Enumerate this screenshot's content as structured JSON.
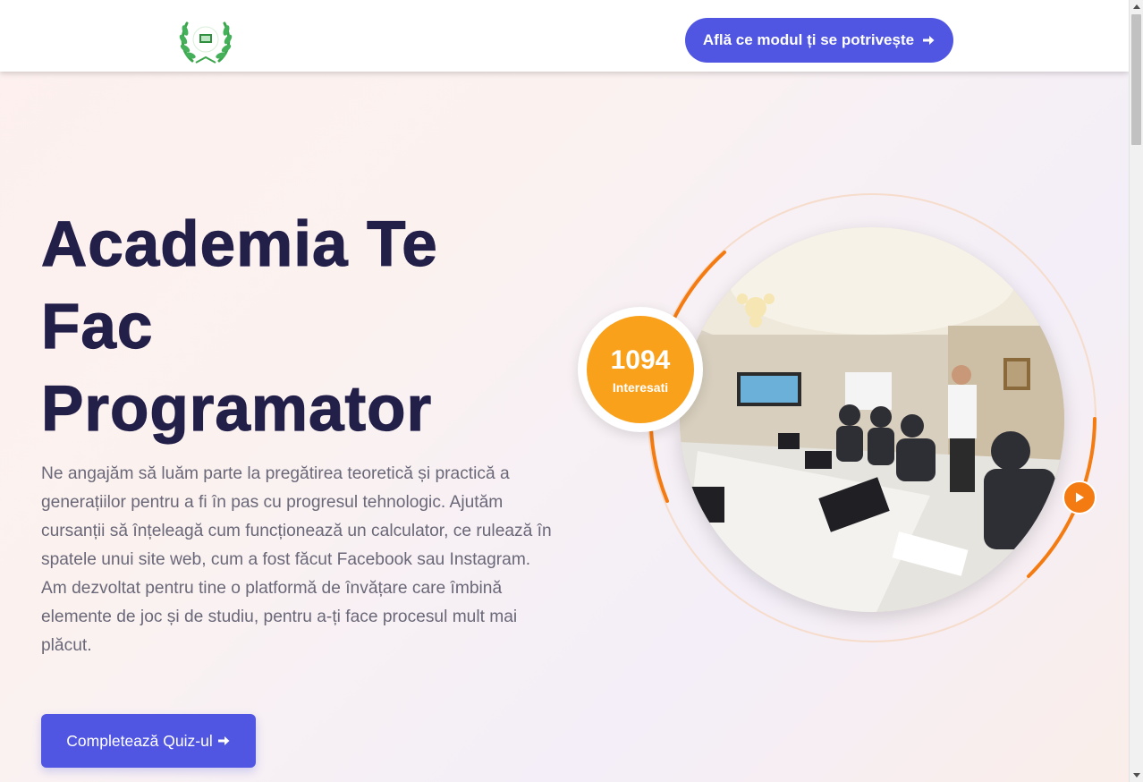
{
  "header": {
    "logo_icon": "laurel-wreath-logo",
    "cta_label": "Află ce modul ți se potrivește",
    "cta_icon": "arrow-right-icon"
  },
  "hero": {
    "title_line1": "Academia Te",
    "title_line2": "Fac",
    "title_line3": "Programator",
    "description": "Ne angajăm să luăm parte la pregătirea teoretică și practică a generațiilor pentru a fi în pas cu progresul tehnologic. Ajutăm cursanții să înțeleagă cum funcționează un calculator, ce rulează în spatele unui site web, cum a fost făcut Facebook sau Instagram. Am dezvoltat pentru tine o platformă de învățare care îmbină elemente de joc și de studiu, pentru a-ți face procesul mult mai plăcut.",
    "quiz_button_label": "Completează Quiz-ul",
    "quiz_button_icon": "arrow-right-icon"
  },
  "stats": {
    "count": "1094",
    "label": "Interesati"
  },
  "media": {
    "photo_icon": "classroom-photo",
    "play_icon": "play-icon"
  },
  "colors": {
    "primary": "#5056e2",
    "title": "#221f49",
    "text": "#6a6878",
    "badge": "#f9a11b",
    "accent_orange": "#f47b11"
  }
}
